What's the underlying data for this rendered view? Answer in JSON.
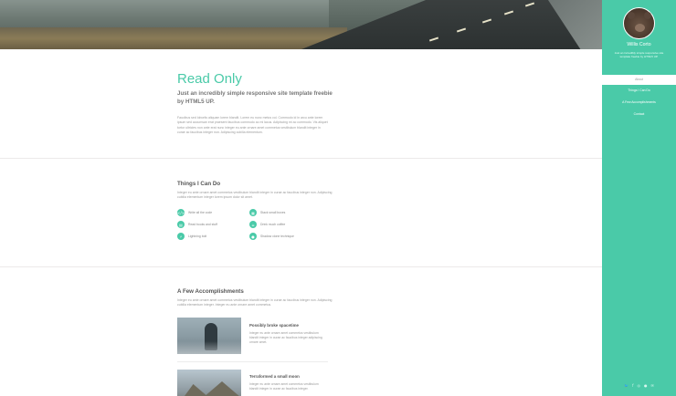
{
  "banner": {
    "icon": "road-landscape-photo"
  },
  "intro": {
    "title": "Read Only",
    "subtitle": "Just an incredibly simple responsive site template freebie by HTML5 UP.",
    "text": "Faucibus sed lobortis aliquam lorem blandit. Lorem eu nunc metus col. Commodo id in arcu ante lorem ipsum sed accumsan erat praesent faucibus commodo ac mi lacus. Adipiscing mi ac commodo. Vis aliquet tortor ultricies non ante erat nunc integer eu ante ornare amet commetus vestibulum blandit integer in curae ac faucibus integer non. Adipiscing cubilia elementum."
  },
  "skills": {
    "heading": "Things I Can Do",
    "text": "Integer eu ante ornare amet commetus vestibulum blandit integer in curae ac faucibus integer non. Adipiscing cubilia elementum integer lorem ipsum dolor sit amet.",
    "features": [
      {
        "label": "Write all the code",
        "icon": "code-icon"
      },
      {
        "label": "Stack small boxes",
        "icon": "cubes-icon"
      },
      {
        "label": "Read books and stuff",
        "icon": "book-icon"
      },
      {
        "label": "Drink much coffee",
        "icon": "coffee-icon"
      },
      {
        "label": "Lightning bolt",
        "icon": "bolt-icon"
      },
      {
        "label": "Shadow clone technique",
        "icon": "users-icon"
      }
    ]
  },
  "accomplishments": {
    "heading": "A Few Accomplishments",
    "text": "Integer eu ante ornare amet commetus vestibulum blandit integer in curae ac faucibus integer non. Adipiscing cubilia elementum integer. Integer eu ante ornare amet commetus.",
    "items": [
      {
        "title": "Possibly broke spacetime",
        "text": "Integer eu ante ornare amet commetus vestibulum blandit integer in curae ac faucibus integer adipiscing ornare amet.",
        "image": "hooded-person-photo"
      },
      {
        "title": "Terraformed a small moon",
        "text": "Integer eu ante ornare amet commetus vestibulum blandit integer in curae ac faucibus integer.",
        "image": "mountain-photo"
      }
    ]
  },
  "sidebar": {
    "name": "Willis Corto",
    "description": "Just an incredibly simple responsive site template freebie by HTML5 UP.",
    "nav": [
      "About",
      "Things I Can Do",
      "A Few Accomplishments",
      "Contact"
    ],
    "active_index": 0,
    "socials": [
      "twitter-icon",
      "facebook-icon",
      "instagram-icon",
      "github-icon",
      "email-icon"
    ]
  },
  "colors": {
    "accent": "#4acaa8",
    "text": "#777777",
    "light_text": "#9a9a9a"
  }
}
